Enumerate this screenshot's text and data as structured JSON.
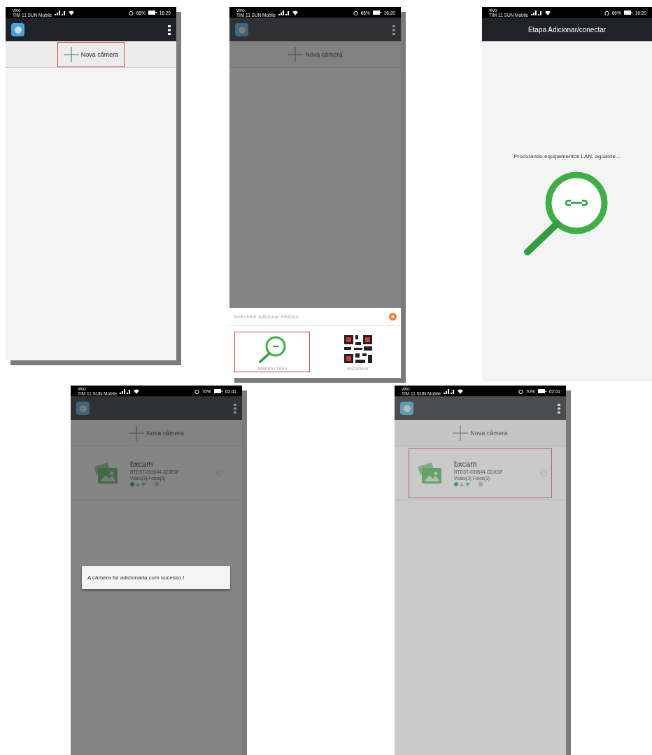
{
  "screens": [
    {
      "kind": "home",
      "dimmed": false,
      "status": {
        "carrier": "vivo",
        "network": "TIM 11 SUN Mobile",
        "battery": "66%",
        "time": "16:29"
      },
      "add_button": {
        "label": "Nova câmera",
        "highlighted": true
      }
    },
    {
      "kind": "home",
      "dimmed": true,
      "status": {
        "carrier": "vivo",
        "network": "TIM 11 SUN Mobile",
        "battery": "66%",
        "time": "16:20"
      },
      "add_button": {
        "label": "Nova câmera",
        "highlighted": false
      },
      "sheet": {
        "title": "Selecione adicionar método",
        "options": [
          {
            "kind": "wifi",
            "label": "Mesmo WiFi",
            "highlighted": true
          },
          {
            "kind": "qr",
            "label": "escanear",
            "highlighted": false
          }
        ]
      }
    },
    {
      "kind": "search",
      "dimmed": false,
      "status": {
        "carrier": "vivo",
        "network": "TIM 11 SUN Mobile",
        "battery": "66%",
        "time": "16:20"
      },
      "title": "Etapa Adicionar/conectar",
      "message": "Procurando equipamentos LAN, aguarde..."
    },
    {
      "kind": "home",
      "dimmed": true,
      "status": {
        "carrier": "vivo",
        "network": "TIM 11 SUN Mobile",
        "battery": "70%",
        "time": "02:41"
      },
      "add_button": {
        "label": "Nova câmera",
        "highlighted": false
      },
      "cameras": [
        {
          "name": "bxcam",
          "uid": "RTEST-039544-GDRSP",
          "stats": "Video(3) Fotos(3)",
          "highlighted": false
        }
      ],
      "toast": "A câmera foi adicionada com sucesso !"
    },
    {
      "kind": "home",
      "dimmed": false,
      "faded": true,
      "status": {
        "carrier": "vivo",
        "network": "TIM 11 SUN Mobile",
        "battery": "70%",
        "time": "02:41"
      },
      "add_button": {
        "label": "Nova câmera",
        "highlighted": false
      },
      "cameras": [
        {
          "name": "bxcam",
          "uid": "RTEST-039544-GDXSP",
          "stats": "Vídeo(3) Fotos(3)",
          "highlighted": true
        }
      ]
    }
  ]
}
